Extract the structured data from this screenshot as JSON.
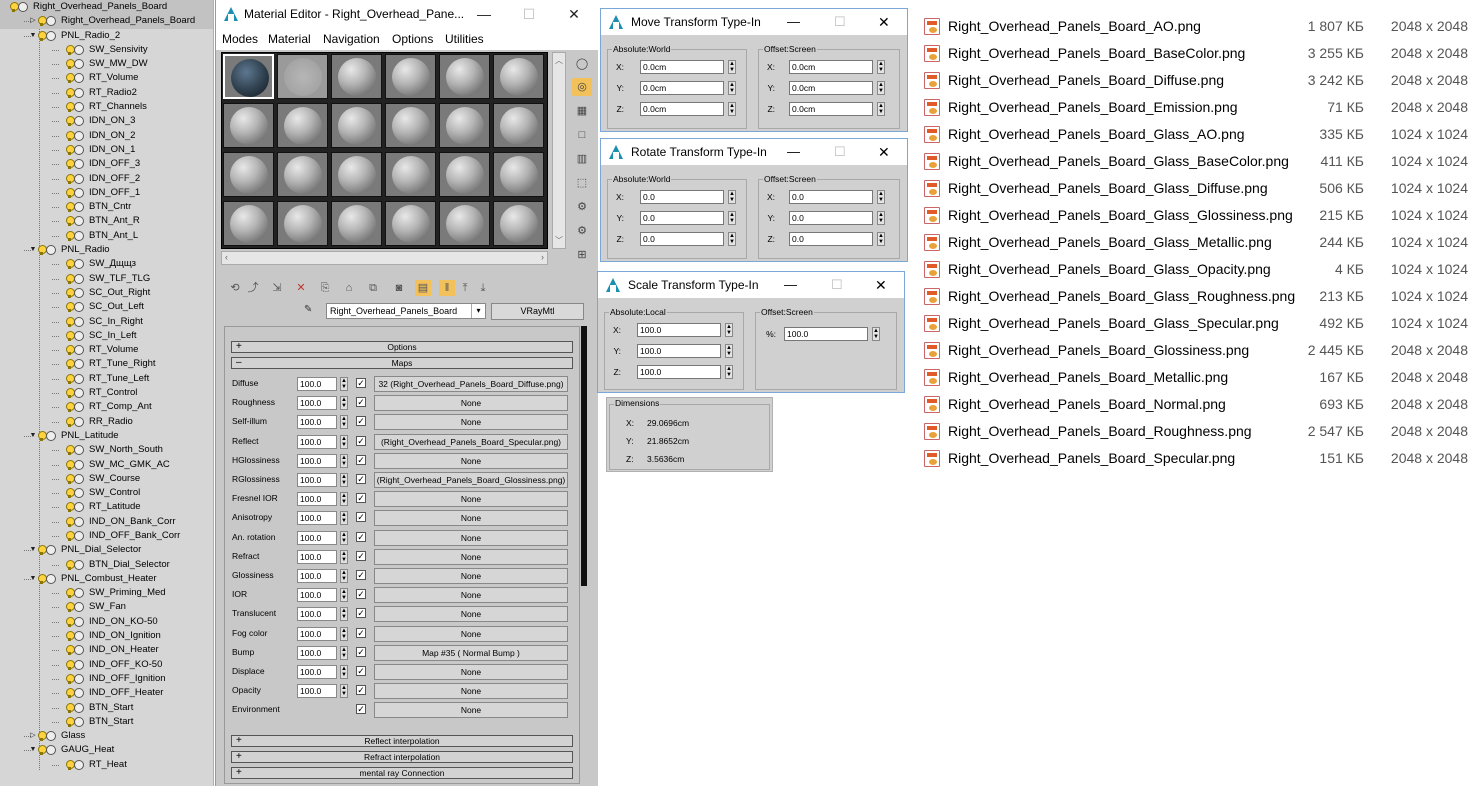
{
  "scene_tree": [
    {
      "label": "Right_Overhead_Panels_Board",
      "depth": 0,
      "expanded": true,
      "selected": true
    },
    {
      "label": "Right_Overhead_Panels_Board",
      "depth": 1,
      "expanded": false,
      "selected": true
    },
    {
      "label": "PNL_Radio_2",
      "depth": 1,
      "expanded": true
    },
    {
      "label": "SW_Sensivity",
      "depth": 2
    },
    {
      "label": "SW_MW_DW",
      "depth": 2
    },
    {
      "label": "RT_Volume",
      "depth": 2
    },
    {
      "label": "RT_Radio2",
      "depth": 2
    },
    {
      "label": "RT_Channels",
      "depth": 2
    },
    {
      "label": "IDN_ON_3",
      "depth": 2
    },
    {
      "label": "IDN_ON_2",
      "depth": 2
    },
    {
      "label": "IDN_ON_1",
      "depth": 2
    },
    {
      "label": "IDN_OFF_3",
      "depth": 2
    },
    {
      "label": "IDN_OFF_2",
      "depth": 2
    },
    {
      "label": "IDN_OFF_1",
      "depth": 2
    },
    {
      "label": "BTN_Cntr",
      "depth": 2
    },
    {
      "label": "BTN_Ant_R",
      "depth": 2
    },
    {
      "label": "BTN_Ant_L",
      "depth": 2
    },
    {
      "label": "PNL_Radio",
      "depth": 1,
      "expanded": true
    },
    {
      "label": "SW_Дщщз",
      "depth": 2
    },
    {
      "label": "SW_TLF_TLG",
      "depth": 2
    },
    {
      "label": "SC_Out_Right",
      "depth": 2
    },
    {
      "label": "SC_Out_Left",
      "depth": 2
    },
    {
      "label": "SC_In_Right",
      "depth": 2
    },
    {
      "label": "SC_In_Left",
      "depth": 2
    },
    {
      "label": "RT_Volume",
      "depth": 2
    },
    {
      "label": "RT_Tune_Right",
      "depth": 2
    },
    {
      "label": "RT_Tune_Left",
      "depth": 2
    },
    {
      "label": "RT_Control",
      "depth": 2
    },
    {
      "label": "RT_Comp_Ant",
      "depth": 2
    },
    {
      "label": "RR_Radio",
      "depth": 2
    },
    {
      "label": "PNL_Latitude",
      "depth": 1,
      "expanded": true
    },
    {
      "label": "SW_North_South",
      "depth": 2
    },
    {
      "label": "SW_MC_GMK_AC",
      "depth": 2
    },
    {
      "label": "SW_Course",
      "depth": 2
    },
    {
      "label": "SW_Control",
      "depth": 2
    },
    {
      "label": "RT_Latitude",
      "depth": 2
    },
    {
      "label": "IND_ON_Bank_Corr",
      "depth": 2
    },
    {
      "label": "IND_OFF_Bank_Corr",
      "depth": 2
    },
    {
      "label": "PNL_Dial_Selector",
      "depth": 1,
      "expanded": true
    },
    {
      "label": "BTN_Dial_Selector",
      "depth": 2
    },
    {
      "label": "PNL_Combust_Heater",
      "depth": 1,
      "expanded": true
    },
    {
      "label": "SW_Priming_Med",
      "depth": 2
    },
    {
      "label": "SW_Fan",
      "depth": 2
    },
    {
      "label": "IND_ON_KO-50",
      "depth": 2
    },
    {
      "label": "IND_ON_Ignition",
      "depth": 2
    },
    {
      "label": "IND_ON_Heater",
      "depth": 2
    },
    {
      "label": "IND_OFF_KO-50",
      "depth": 2
    },
    {
      "label": "IND_OFF_Ignition",
      "depth": 2
    },
    {
      "label": "IND_OFF_Heater",
      "depth": 2
    },
    {
      "label": "BTN_Start",
      "depth": 2
    },
    {
      "label": "BTN_Start",
      "depth": 2
    },
    {
      "label": "Glass",
      "depth": 1,
      "expanded": false
    },
    {
      "label": "GAUG_Heat",
      "depth": 1,
      "expanded": true
    },
    {
      "label": "RT_Heat",
      "depth": 2
    }
  ],
  "material_editor": {
    "title": "Material Editor - Right_Overhead_Pane...",
    "menu": [
      "Modes",
      "Material",
      "Navigation",
      "Options",
      "Utilities"
    ],
    "material_name": "Right_Overhead_Panels_Board",
    "material_type": "VRayMtl",
    "rollouts_top": [
      {
        "sign": "+",
        "label": "Options"
      },
      {
        "sign": "–",
        "label": "Maps"
      }
    ],
    "maps": [
      {
        "label": "Diffuse",
        "value": "100.0",
        "check": true,
        "map": "32 (Right_Overhead_Panels_Board_Diffuse.png)"
      },
      {
        "label": "Roughness",
        "value": "100.0",
        "check": true,
        "map": "None"
      },
      {
        "label": "Self-illum",
        "value": "100.0",
        "check": true,
        "map": "None"
      },
      {
        "label": "Reflect",
        "value": "100.0",
        "check": true,
        "map": "(Right_Overhead_Panels_Board_Specular.png)"
      },
      {
        "label": "HGlossiness",
        "value": "100.0",
        "check": true,
        "map": "None"
      },
      {
        "label": "RGlossiness",
        "value": "100.0",
        "check": true,
        "map": "(Right_Overhead_Panels_Board_Glossiness.png)"
      },
      {
        "label": "Fresnel IOR",
        "value": "100.0",
        "check": true,
        "map": "None"
      },
      {
        "label": "Anisotropy",
        "value": "100.0",
        "check": true,
        "map": "None"
      },
      {
        "label": "An. rotation",
        "value": "100.0",
        "check": true,
        "map": "None"
      },
      {
        "label": "Refract",
        "value": "100.0",
        "check": true,
        "map": "None"
      },
      {
        "label": "Glossiness",
        "value": "100.0",
        "check": true,
        "map": "None"
      },
      {
        "label": "IOR",
        "value": "100.0",
        "check": true,
        "map": "None"
      },
      {
        "label": "Translucent",
        "value": "100.0",
        "check": true,
        "map": "None"
      },
      {
        "label": "Fog color",
        "value": "100.0",
        "check": true,
        "map": "None"
      },
      {
        "label": "Bump",
        "value": "100.0",
        "check": true,
        "map": "Map #35  ( Normal Bump )"
      },
      {
        "label": "Displace",
        "value": "100.0",
        "check": true,
        "map": "None"
      },
      {
        "label": "Opacity",
        "value": "100.0",
        "check": true,
        "map": "None"
      },
      {
        "label": "Environment",
        "value": "",
        "check": true,
        "map": "None"
      }
    ],
    "rollouts_bottom": [
      {
        "sign": "+",
        "label": "Reflect interpolation"
      },
      {
        "sign": "+",
        "label": "Refract interpolation"
      },
      {
        "sign": "+",
        "label": "mental ray Connection"
      }
    ]
  },
  "move_dialog": {
    "title": "Move Transform Type-In",
    "abs_title": "Absolute:World",
    "off_title": "Offset:Screen",
    "abs": {
      "x": "0.0cm",
      "y": "0.0cm",
      "z": "0.0cm"
    },
    "off": {
      "x": "0.0cm",
      "y": "0.0cm",
      "z": "0.0cm"
    }
  },
  "rotate_dialog": {
    "title": "Rotate Transform Type-In",
    "abs_title": "Absolute:World",
    "off_title": "Offset:Screen",
    "abs": {
      "x": "0.0",
      "y": "0.0",
      "z": "0.0"
    },
    "off": {
      "x": "0.0",
      "y": "0.0",
      "z": "0.0"
    }
  },
  "scale_dialog": {
    "title": "Scale Transform Type-In",
    "abs_title": "Absolute:Local",
    "off_title": "Offset:Screen",
    "abs": {
      "x": "100.0",
      "y": "100.0",
      "z": "100.0"
    },
    "off": {
      "pct_label": "%:",
      "pct": "100.0"
    }
  },
  "dimensions": {
    "title": "Dimensions",
    "x": "29.0696cm",
    "y": "21.8652cm",
    "z": "3.5636cm"
  },
  "files": [
    {
      "name": "Right_Overhead_Panels_Board_AO.png",
      "size": "1 807 КБ",
      "dims": "2048 x 2048"
    },
    {
      "name": "Right_Overhead_Panels_Board_BaseColor.png",
      "size": "3 255 КБ",
      "dims": "2048 x 2048"
    },
    {
      "name": "Right_Overhead_Panels_Board_Diffuse.png",
      "size": "3 242 КБ",
      "dims": "2048 x 2048"
    },
    {
      "name": "Right_Overhead_Panels_Board_Emission.png",
      "size": "71 КБ",
      "dims": "2048 x 2048"
    },
    {
      "name": "Right_Overhead_Panels_Board_Glass_AO.png",
      "size": "335 КБ",
      "dims": "1024 x 1024"
    },
    {
      "name": "Right_Overhead_Panels_Board_Glass_BaseColor.png",
      "size": "411 КБ",
      "dims": "1024 x 1024"
    },
    {
      "name": "Right_Overhead_Panels_Board_Glass_Diffuse.png",
      "size": "506 КБ",
      "dims": "1024 x 1024"
    },
    {
      "name": "Right_Overhead_Panels_Board_Glass_Glossiness.png",
      "size": "215 КБ",
      "dims": "1024 x 1024"
    },
    {
      "name": "Right_Overhead_Panels_Board_Glass_Metallic.png",
      "size": "244 КБ",
      "dims": "1024 x 1024"
    },
    {
      "name": "Right_Overhead_Panels_Board_Glass_Opacity.png",
      "size": "4 КБ",
      "dims": "1024 x 1024"
    },
    {
      "name": "Right_Overhead_Panels_Board_Glass_Roughness.png",
      "size": "213 КБ",
      "dims": "1024 x 1024"
    },
    {
      "name": "Right_Overhead_Panels_Board_Glass_Specular.png",
      "size": "492 КБ",
      "dims": "1024 x 1024"
    },
    {
      "name": "Right_Overhead_Panels_Board_Glossiness.png",
      "size": "2 445 КБ",
      "dims": "2048 x 2048"
    },
    {
      "name": "Right_Overhead_Panels_Board_Metallic.png",
      "size": "167 КБ",
      "dims": "2048 x 2048"
    },
    {
      "name": "Right_Overhead_Panels_Board_Normal.png",
      "size": "693 КБ",
      "dims": "2048 x 2048"
    },
    {
      "name": "Right_Overhead_Panels_Board_Roughness.png",
      "size": "2 547 КБ",
      "dims": "2048 x 2048"
    },
    {
      "name": "Right_Overhead_Panels_Board_Specular.png",
      "size": "151 КБ",
      "dims": "2048 x 2048"
    }
  ]
}
